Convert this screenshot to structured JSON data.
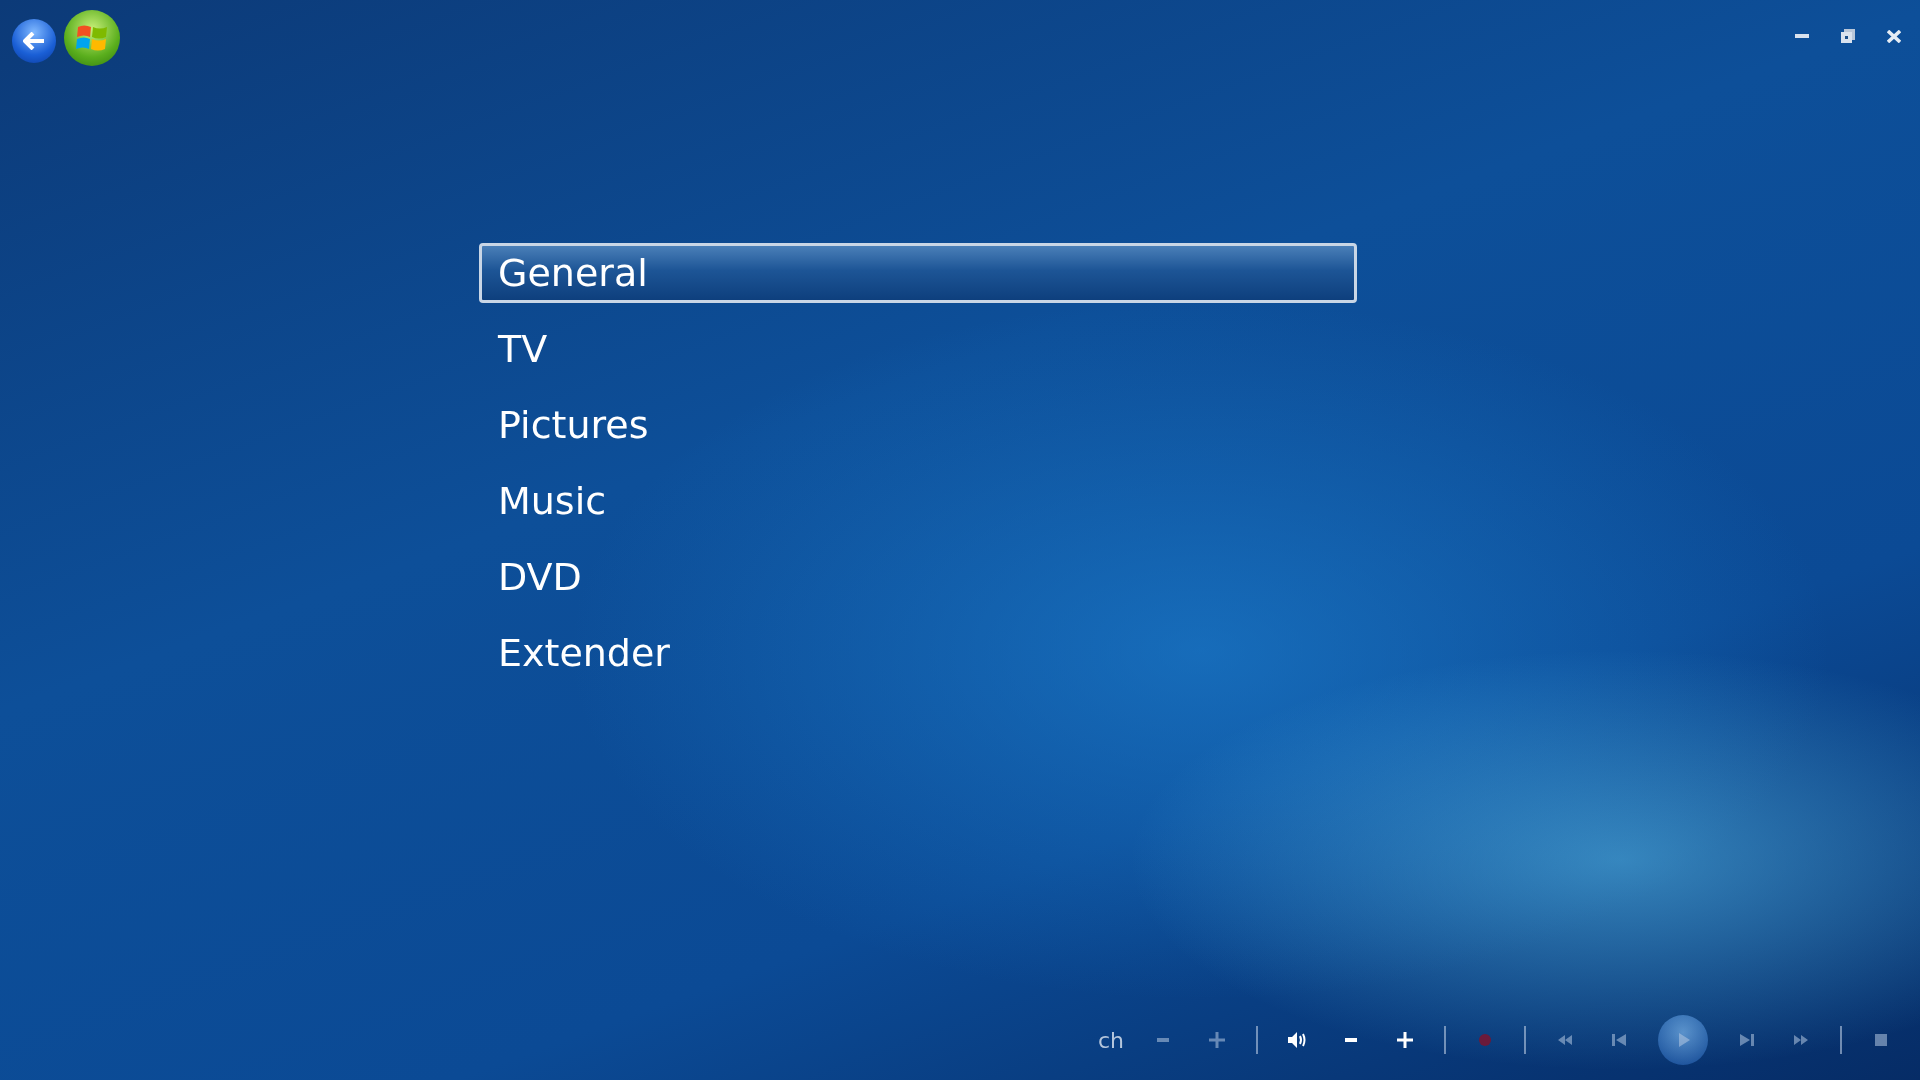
{
  "menu": [
    {
      "label": "General",
      "selected": true
    },
    {
      "label": "TV",
      "selected": false
    },
    {
      "label": "Pictures",
      "selected": false
    },
    {
      "label": "Music",
      "selected": false
    },
    {
      "label": "DVD",
      "selected": false
    },
    {
      "label": "Extender",
      "selected": false
    }
  ],
  "transport": {
    "channel_label": "ch",
    "controls": [
      {
        "kind": "minus",
        "disabled": true
      },
      {
        "kind": "plus",
        "disabled": true
      },
      {
        "kind": "sep"
      },
      {
        "kind": "speaker",
        "disabled": false
      },
      {
        "kind": "minus",
        "disabled": false
      },
      {
        "kind": "plus",
        "disabled": false
      },
      {
        "kind": "sep"
      },
      {
        "kind": "record",
        "disabled": true
      },
      {
        "kind": "sep"
      },
      {
        "kind": "rewind",
        "disabled": true
      },
      {
        "kind": "previous",
        "disabled": true
      },
      {
        "kind": "play",
        "disabled": true
      },
      {
        "kind": "next",
        "disabled": true
      },
      {
        "kind": "forward",
        "disabled": true
      },
      {
        "kind": "sep"
      },
      {
        "kind": "stop",
        "disabled": true
      }
    ]
  }
}
